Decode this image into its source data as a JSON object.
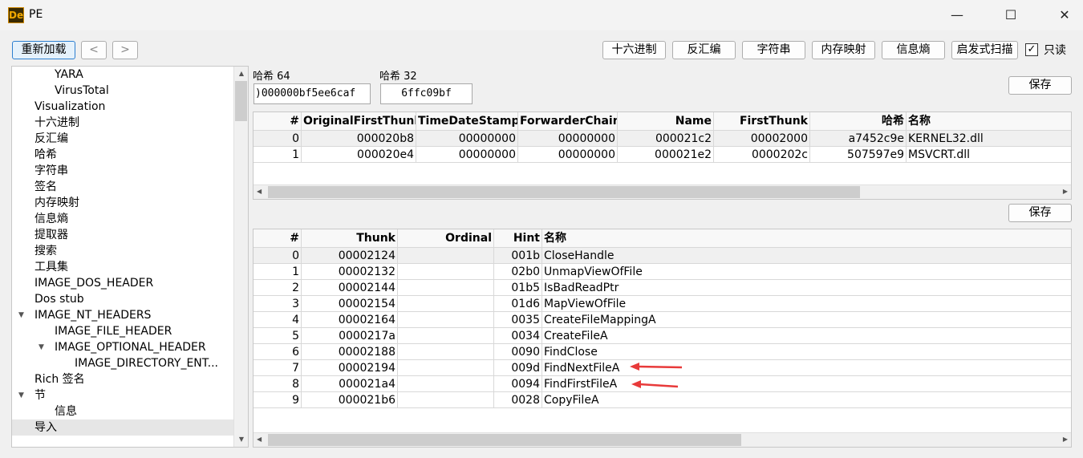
{
  "window": {
    "title": "PE",
    "minimize": "—",
    "maximize": "☐",
    "close": "✕",
    "logo": "De"
  },
  "toolbar": {
    "reload": "重新加载",
    "back": "<",
    "forward": ">",
    "buttons": [
      "十六进制",
      "反汇编",
      "字符串",
      "内存映射",
      "信息熵",
      "启发式扫描"
    ],
    "readonly_label": "只读",
    "readonly_checked": true
  },
  "tree": {
    "items": [
      {
        "label": "YARA",
        "level": 2
      },
      {
        "label": "VirusTotal",
        "level": 2
      },
      {
        "label": "Visualization",
        "level": 1
      },
      {
        "label": "十六进制",
        "level": 1
      },
      {
        "label": "反汇编",
        "level": 1
      },
      {
        "label": "哈希",
        "level": 1
      },
      {
        "label": "字符串",
        "level": 1
      },
      {
        "label": "签名",
        "level": 1
      },
      {
        "label": "内存映射",
        "level": 1
      },
      {
        "label": "信息熵",
        "level": 1
      },
      {
        "label": "提取器",
        "level": 1
      },
      {
        "label": "搜索",
        "level": 1
      },
      {
        "label": "工具集",
        "level": 1
      },
      {
        "label": "IMAGE_DOS_HEADER",
        "level": 1
      },
      {
        "label": "Dos stub",
        "level": 1
      },
      {
        "label": "IMAGE_NT_HEADERS",
        "level": 1,
        "expanded": true
      },
      {
        "label": "IMAGE_FILE_HEADER",
        "level": 2
      },
      {
        "label": "IMAGE_OPTIONAL_HEADER",
        "level": 2,
        "expanded": true
      },
      {
        "label": "IMAGE_DIRECTORY_ENT...",
        "level": 3
      },
      {
        "label": "Rich 签名",
        "level": 1
      },
      {
        "label": "节",
        "level": 1,
        "expanded": true
      },
      {
        "label": "信息",
        "level": 2
      },
      {
        "label": "导入",
        "level": 1,
        "selected": true
      }
    ]
  },
  "hash": {
    "hash64_label": "哈希 64",
    "hash64_value": ")000000bf5ee6caf",
    "hash32_label": "哈希 32",
    "hash32_value": "6ffc09bf"
  },
  "save_label": "保存",
  "imports_table": {
    "columns": [
      "#",
      "OriginalFirstThunk",
      "TimeDateStamp",
      "ForwarderChain",
      "Name",
      "FirstThunk",
      "哈希",
      "名称"
    ],
    "rows": [
      [
        "0",
        "000020b8",
        "00000000",
        "00000000",
        "000021c2",
        "00002000",
        "a7452c9e",
        "KERNEL32.dll"
      ],
      [
        "1",
        "000020e4",
        "00000000",
        "00000000",
        "000021e2",
        "0000202c",
        "507597e9",
        "MSVCRT.dll"
      ]
    ]
  },
  "functions_table": {
    "columns": [
      "#",
      "Thunk",
      "Ordinal",
      "Hint",
      "名称"
    ],
    "rows": [
      [
        "0",
        "00002124",
        "",
        "001b",
        "CloseHandle"
      ],
      [
        "1",
        "00002132",
        "",
        "02b0",
        "UnmapViewOfFile"
      ],
      [
        "2",
        "00002144",
        "",
        "01b5",
        "IsBadReadPtr"
      ],
      [
        "3",
        "00002154",
        "",
        "01d6",
        "MapViewOfFile"
      ],
      [
        "4",
        "00002164",
        "",
        "0035",
        "CreateFileMappingA"
      ],
      [
        "5",
        "0000217a",
        "",
        "0034",
        "CreateFileA"
      ],
      [
        "6",
        "00002188",
        "",
        "0090",
        "FindClose"
      ],
      [
        "7",
        "00002194",
        "",
        "009d",
        "FindNextFileA"
      ],
      [
        "8",
        "000021a4",
        "",
        "0094",
        "FindFirstFileA"
      ],
      [
        "9",
        "000021b6",
        "",
        "0028",
        "CopyFileA"
      ]
    ]
  },
  "annotation_color": "#e83a3a"
}
